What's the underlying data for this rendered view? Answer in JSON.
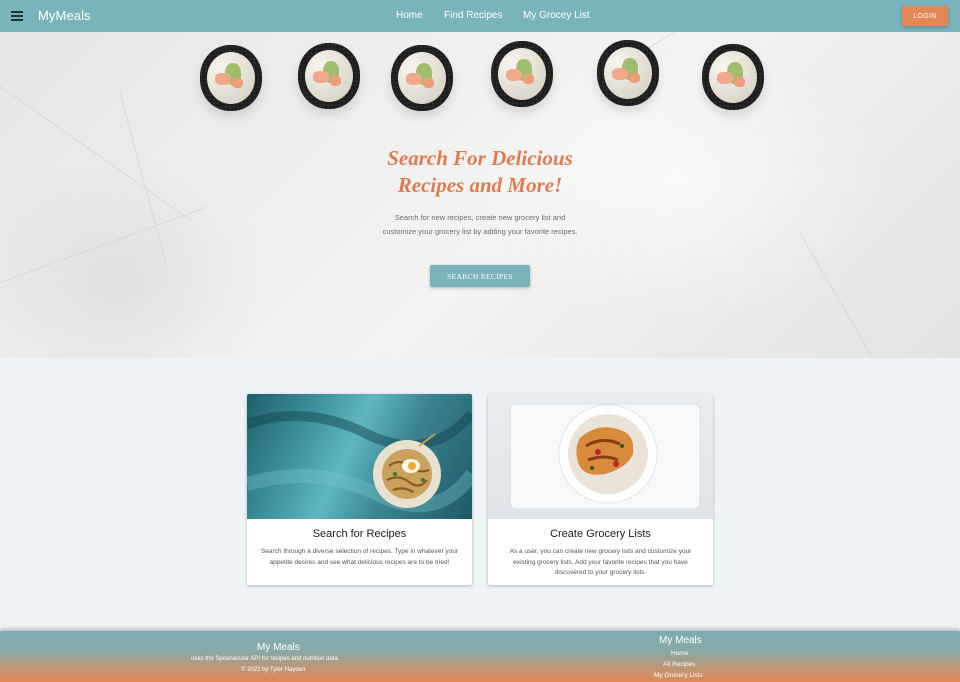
{
  "navbar": {
    "brand": "MyMeals",
    "menu_icon": "hamburger-menu-icon",
    "links": [
      "Home",
      "Find Recipes",
      "My Grocey List"
    ],
    "login": "LOGIN",
    "color": "#79b4bb",
    "login_color": "#e58656"
  },
  "hero": {
    "title_line1": "Search For Delicious",
    "title_line2": "Recipes and More!",
    "text": "Search for new recipes, create new grocery list and customize your grocery list by adding your favorite recipes.",
    "button": "SEARCH RECIPES",
    "title_color": "#e07b4f"
  },
  "cards": [
    {
      "title": "Search for Recipes",
      "text": "Search through a diverse selection of recipes. Type in whatever your appetite desires and see what delicious recipes are to be tried!"
    },
    {
      "title": "Create Grocery Lists",
      "text": "As a user, you can create new grocery lists and customize your existing grocery lists. Add your favorite recipes that you have discovered to your grocery lists."
    }
  ],
  "footer": {
    "left_title": "My Meals",
    "left_line1": "uses the Spoonacular API for recipes and nutrition data.",
    "left_line2": "© 2022 by Tyler Hayden",
    "right_title": "My Meals",
    "links": [
      "Home",
      "All Recipes",
      "My Grocery Lists"
    ]
  }
}
